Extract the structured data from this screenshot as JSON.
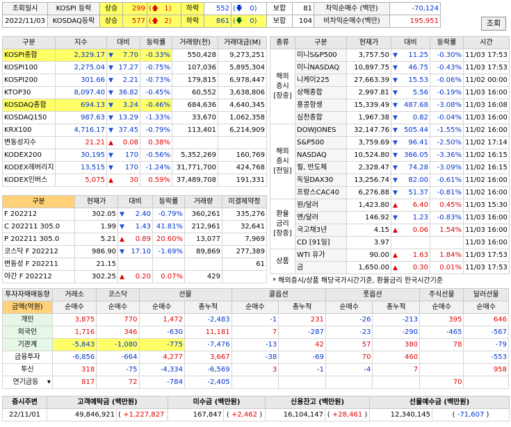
{
  "top": {
    "lookup_label": "조회일시",
    "date": "2022/11/03",
    "kospi_label": "KOSPI 등락",
    "kosdaq_label": "KOSDAQ등락",
    "rise_label": "상승",
    "fall_label": "하락",
    "flat_label": "보합",
    "kospi_rise": "299",
    "kospi_upper": "1",
    "kospi_fall": "552",
    "kospi_lower": "0",
    "kospi_flat": "81",
    "kosdaq_rise": "577",
    "kosdaq_upper": "2",
    "kosdaq_fall": "861",
    "kosdaq_lower": "0",
    "kosdaq_flat": "104",
    "arb_label": "차익순매수 (백만)",
    "arb_value": "-70,124",
    "nonarb_label": "비차익순매수(백만)",
    "nonarb_value": "195,951",
    "query_button": "조회"
  },
  "index_table": {
    "headers": [
      "구분",
      "지수",
      "대비",
      "등락률",
      "거래량(천)",
      "거래대금(M)"
    ],
    "rows": [
      {
        "name": "KOSPI종합",
        "value": "2,329.17",
        "dir": "dn",
        "change": "7.70",
        "rate": "-0.33%",
        "volume": "550,428",
        "amount": "9,273,251",
        "hl": true
      },
      {
        "name": "KOSPI100",
        "value": "2,275.04",
        "dir": "dn",
        "change": "17.27",
        "rate": "-0.75%",
        "volume": "107,036",
        "amount": "5,895,304"
      },
      {
        "name": "KOSPI200",
        "value": "301.66",
        "dir": "dn",
        "change": "2.21",
        "rate": "-0.73%",
        "volume": "179,815",
        "amount": "6,978,447"
      },
      {
        "name": "KTOP30",
        "value": "8,097.40",
        "dir": "dn",
        "change": "36.82",
        "rate": "-0.45%",
        "volume": "60,552",
        "amount": "3,638,806"
      },
      {
        "name": "KOSDAQ종합",
        "value": "694.13",
        "dir": "dn",
        "change": "3.24",
        "rate": "-0.46%",
        "volume": "684,636",
        "amount": "4,640,345",
        "hl": true
      },
      {
        "name": "KOSDAQ150",
        "value": "987.63",
        "dir": "dn",
        "change": "13.29",
        "rate": "-1.33%",
        "volume": "33,670",
        "amount": "1,062,358"
      },
      {
        "name": "KRX100",
        "value": "4,716.17",
        "dir": "dn",
        "change": "37.45",
        "rate": "-0.79%",
        "volume": "113,401",
        "amount": "6,214,909"
      },
      {
        "name": "변동성지수",
        "value": "21.21",
        "dir": "up",
        "change": "0.08",
        "rate": "0.38%",
        "volume": "",
        "amount": ""
      },
      {
        "name": "KODEX200",
        "value": "30,195",
        "dir": "dn",
        "change": "170",
        "rate": "-0.56%",
        "volume": "5,352,269",
        "amount": "160,769"
      },
      {
        "name": "KODEX레버리지",
        "value": "13,515",
        "dir": "dn",
        "change": "170",
        "rate": "-1.24%",
        "volume": "31,771,700",
        "amount": "424,768"
      },
      {
        "name": "KODEX인버스",
        "value": "5,075",
        "dir": "up",
        "change": "30",
        "rate": "0.59%",
        "volume": "37,489,708",
        "amount": "191,331"
      }
    ]
  },
  "futures_table": {
    "headers": [
      "구분",
      "현재가",
      "대비",
      "등락률",
      "거래량",
      "미결제약정"
    ],
    "rows": [
      {
        "name": "F 202212",
        "value": "302.05",
        "dir": "dn",
        "change": "2.40",
        "rate": "-0.79%",
        "volume": "360,261",
        "oi": "335,276"
      },
      {
        "name": "C 202211 305.0",
        "value": "1.99",
        "dir": "dn",
        "change": "1.43",
        "rate": "41.81%",
        "volume": "212,961",
        "oi": "32,641"
      },
      {
        "name": "P 202211 305.0",
        "value": "5.21",
        "dir": "up",
        "change": "0.89",
        "rate": "20.60%",
        "volume": "13,077",
        "oi": "7,969"
      },
      {
        "name": "코스닥 F 202212",
        "value": "986.90",
        "dir": "dn",
        "change": "17.10",
        "rate": "-1.69%",
        "volume": "89,869",
        "oi": "277,389"
      },
      {
        "name": "변동성 F 202211",
        "value": "21.15",
        "dir": "",
        "change": "",
        "rate": "",
        "volume": "",
        "oi": "61"
      },
      {
        "name": "야간 F 202212",
        "value": "302.25",
        "dir": "up",
        "change": "0.20",
        "rate": "0.07%",
        "volume": "429",
        "oi": ""
      }
    ]
  },
  "overseas_table": {
    "headers": [
      "종류",
      "구분",
      "현재가",
      "대비",
      "등락률",
      "시간"
    ],
    "groups": [
      {
        "label": "해외\n증시\n[장중]",
        "rows": [
          {
            "name": "미니S&P500",
            "value": "3,757.50",
            "dir": "dn",
            "change": "11.25",
            "rate": "-0.30%",
            "time": "11/03 17:53"
          },
          {
            "name": "미니NASDAQ",
            "value": "10,897.75",
            "dir": "dn",
            "change": "46.75",
            "rate": "-0.43%",
            "time": "11/03 17:53"
          },
          {
            "name": "니케이225",
            "value": "27,663.39",
            "dir": "dn",
            "change": "15.53",
            "rate": "-0.06%",
            "time": "11/02 00:00"
          },
          {
            "name": "상해종합",
            "value": "2,997.81",
            "dir": "dn",
            "change": "5.56",
            "rate": "-0.19%",
            "time": "11/03 16:00"
          },
          {
            "name": "홍콩항셍",
            "value": "15,339.49",
            "dir": "dn",
            "change": "487.68",
            "rate": "-3.08%",
            "time": "11/03 16:08"
          },
          {
            "name": "심천종합",
            "value": "1,967.38",
            "dir": "dn",
            "change": "0.82",
            "rate": "-0.04%",
            "time": "11/03 16:00"
          }
        ]
      },
      {
        "label": "해외\n증시\n[전일]",
        "rows": [
          {
            "name": "DOWJONES",
            "value": "32,147.76",
            "dir": "dn",
            "change": "505.44",
            "rate": "-1.55%",
            "time": "11/02 16:00"
          },
          {
            "name": "S&P500",
            "value": "3,759.69",
            "dir": "dn",
            "change": "96.41",
            "rate": "-2.50%",
            "time": "11/02 17:14"
          },
          {
            "name": "NASDAQ",
            "value": "10,524.80",
            "dir": "dn",
            "change": "366.05",
            "rate": "-3.36%",
            "time": "11/02 16:15"
          },
          {
            "name": "필, 반도체",
            "value": "2,328.47",
            "dir": "dn",
            "change": "74.28",
            "rate": "-3.09%",
            "time": "11/02 16:15"
          },
          {
            "name": "독일DAX30",
            "value": "13,256.74",
            "dir": "dn",
            "change": "82.00",
            "rate": "-0.61%",
            "time": "11/02 16:00"
          },
          {
            "name": "프랑스CAC40",
            "value": "6,276.88",
            "dir": "dn",
            "change": "51.37",
            "rate": "-0.81%",
            "time": "11/02 16:00"
          }
        ]
      },
      {
        "label": "환율\n금리\n[장중]",
        "rows": [
          {
            "name": "원/달러",
            "value": "1,423.80",
            "dir": "up",
            "change": "6.40",
            "rate": "0.45%",
            "time": "11/03 15:30"
          },
          {
            "name": "엔/달러",
            "value": "146.92",
            "dir": "dn",
            "change": "1.23",
            "rate": "-0.83%",
            "time": "11/03 16:00"
          },
          {
            "name": "국고채3년",
            "value": "4.15",
            "dir": "up",
            "change": "0.06",
            "rate": "1.54%",
            "time": "11/03 16:00"
          },
          {
            "name": "CD [91일]",
            "value": "3.97",
            "dir": "",
            "change": "",
            "rate": "",
            "time": "11/03 16:00"
          }
        ]
      },
      {
        "label": "상품",
        "rows": [
          {
            "name": "WTI 유가",
            "value": "90.00",
            "dir": "up",
            "change": "1.63",
            "rate": "1.84%",
            "time": "11/03 17:53"
          },
          {
            "name": "금",
            "value": "1,650.00",
            "dir": "up",
            "change": "0.30",
            "rate": "0.01%",
            "time": "11/03 17:53"
          }
        ]
      }
    ],
    "note": "* 해외증시/상품 해당국가시간기준, 환율금리 한국시간기준"
  },
  "investor_table": {
    "title_label": "투자자매매동향",
    "unit_label": "금액(억원)",
    "groups": [
      "거래소",
      "코스닥",
      "선물",
      "콜옵션",
      "풋옵션",
      "주식선물",
      "달러선물"
    ],
    "sub_net": "순매수",
    "sub_cum": "총누적",
    "rows": [
      {
        "name": "개인",
        "v": [
          "3,875",
          "770",
          "1,472",
          "-2,483",
          "-1",
          "231",
          "-26",
          "-213",
          "395",
          "646"
        ]
      },
      {
        "name": "외국인",
        "v": [
          "1,716",
          "346",
          "-630",
          "11,181",
          "7",
          "-287",
          "-23",
          "-290",
          "-465",
          "-567"
        ]
      },
      {
        "name": "기관계",
        "v": [
          "-5,843",
          "-1,080",
          "-775",
          "-7,476",
          "-13",
          "42",
          "57",
          "380",
          "78",
          "-79"
        ]
      },
      {
        "name": "금융투자",
        "v": [
          "-6,856",
          "-664",
          "4,277",
          "3,667",
          "-38",
          "-69",
          "70",
          "460",
          "",
          "-553"
        ]
      },
      {
        "name": "투신",
        "v": [
          "318",
          "-75",
          "-4,334",
          "-6,569",
          "3",
          "-1",
          "-4",
          "7",
          "",
          "958"
        ]
      },
      {
        "name": "연기금등",
        "v": [
          "817",
          "72",
          "-784",
          "-2,405",
          "",
          "",
          "",
          "",
          "70",
          ""
        ]
      }
    ]
  },
  "bottom": {
    "headers": [
      "증시주변",
      "고객예탁금 (백만원)",
      "미수금 (백만원)",
      "신용잔고 (백만원)",
      "선물예수금 (백만원)"
    ],
    "date": "22/11/01",
    "deposit": "49,846,921",
    "deposit_chg": "+1,227,827",
    "unpaid": "167,847",
    "unpaid_chg": "+2,462",
    "credit": "16,104,147",
    "credit_chg": "+28,461",
    "fut_deposit": "12,340,145",
    "fut_deposit_chg": "-71,607"
  }
}
